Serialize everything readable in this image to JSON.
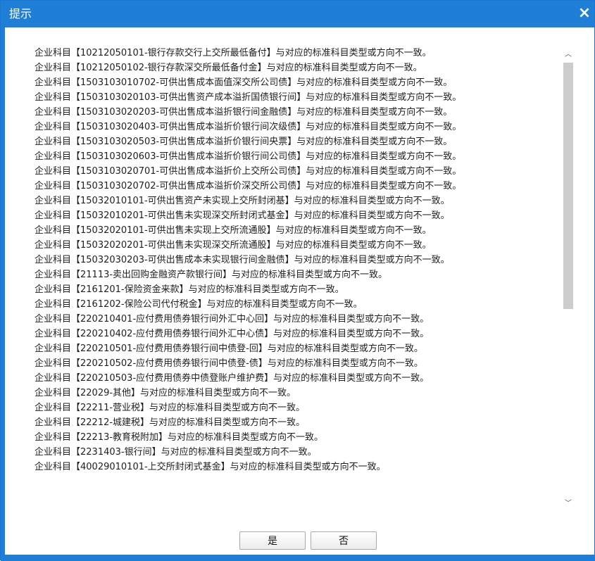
{
  "dialog": {
    "title": "提示",
    "close_icon": "×",
    "scroll_up_icon": "︿",
    "scroll_down_icon": "﹀",
    "lines": [
      "企业科目【10212050101-银行存款交行上交所最低备付】与对应的标准科目类型或方向不一致。",
      "企业科目【10212050102-银行存款深交所最低备付金】与对应的标准科目类型或方向不一致。",
      "企业科目【1503103010702-可供出售成本面值深交所公司债】与对应的标准科目类型或方向不一致。",
      "企业科目【1503103020103-可供出售资产成本溢折国债银行间】与对应的标准科目类型或方向不一致。",
      "企业科目【1503103020203-可供出售成本溢折银行间金融债】与对应的标准科目类型或方向不一致。",
      "企业科目【1503103020403-可供出售成本溢折价银行间次级债】与对应的标准科目类型或方向不一致。",
      "企业科目【1503103020503-可供出售成本溢折价银行间央票】与对应的标准科目类型或方向不一致。",
      "企业科目【1503103020603-可供出售成本溢折价银行间公司债】与对应的标准科目类型或方向不一致。",
      "企业科目【1503103020701-可供出售成本溢折价上交所公司债】与对应的标准科目类型或方向不一致。",
      "企业科目【1503103020702-可供出售成本溢折价深交所公司债】与对应的标准科目类型或方向不一致。",
      "企业科目【15032010101-可供出售资产未实现上交所封闭基】与对应的标准科目类型或方向不一致。",
      "企业科目【15032010201-可供出售未实现深交所封闭式基金】与对应的标准科目类型或方向不一致。",
      "企业科目【15032020101-可供出售未实现上交所流通股】与对应的标准科目类型或方向不一致。",
      "企业科目【15032020201-可供出售未实现深交所流通股】与对应的标准科目类型或方向不一致。",
      "企业科目【15032030203-可供出售成本未实现银行间金融债】与对应的标准科目类型或方向不一致。",
      "企业科目【21113-卖出回购金融资产款银行间】与对应的标准科目类型或方向不一致。",
      "企业科目【2161201-保险资金来款】与对应的标准科目类型或方向不一致。",
      "企业科目【2161202-保险公司代付税金】与对应的标准科目类型或方向不一致。",
      "企业科目【220210401-应付费用债券银行间外汇中心回】与对应的标准科目类型或方向不一致。",
      "企业科目【220210402-应付费用债券银行间外汇中心债】与对应的标准科目类型或方向不一致。",
      "企业科目【220210501-应付费用债券银行间中债登-回】与对应的标准科目类型或方向不一致。",
      "企业科目【220210502-应付费用债券银行间中债登-债】与对应的标准科目类型或方向不一致。",
      "企业科目【220210503-应付费用债券中债登账户维护费】与对应的标准科目类型或方向不一致。",
      "企业科目【22029-其他】与对应的标准科目类型或方向不一致。",
      "企业科目【22211-营业税】与对应的标准科目类型或方向不一致。",
      "企业科目【22212-城建税】与对应的标准科目类型或方向不一致。",
      "企业科目【22213-教育税附加】与对应的标准科目类型或方向不一致。",
      "企业科目【2231403-银行间】与对应的标准科目类型或方向不一致。",
      "企业科目【40029010101-上交所封闭式基金】与对应的标准科目类型或方向不一致。"
    ],
    "buttons": {
      "yes": "是",
      "no": "否"
    }
  },
  "colors": {
    "titlebar": "#1f7fd7",
    "text": "#202020"
  }
}
